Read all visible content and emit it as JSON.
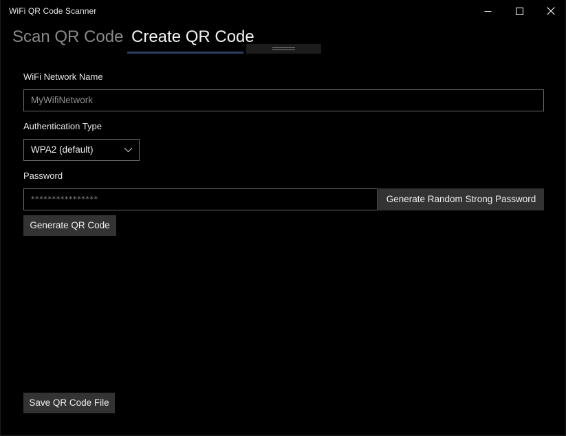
{
  "window": {
    "title": "WiFi QR Code Scanner",
    "caption": {
      "minimize_label": "Minimize",
      "maximize_label": "Maximize",
      "close_label": "Close"
    }
  },
  "tabs": [
    {
      "label": "Scan QR Code",
      "selected": false
    },
    {
      "label": "Create QR Code",
      "selected": true
    }
  ],
  "drag_handle": {
    "name": "window-drag-handle"
  },
  "form": {
    "ssid": {
      "label": "WiFi Network Name",
      "value": "",
      "placeholder": "MyWifiNetwork"
    },
    "auth": {
      "label": "Authentication Type",
      "selected": "WPA2 (default)",
      "options": [
        "WPA2 (default)"
      ]
    },
    "password": {
      "label": "Password",
      "value": "****************",
      "placeholder": ""
    },
    "generate_password_button": "Generate Random Strong Password",
    "generate_qr_button": "Generate QR Code",
    "save_button": "Save QR Code File"
  },
  "colors": {
    "background": "#000000",
    "accent_underline": "#2b3e66",
    "button_face": "#333333",
    "input_border": "#6b6b6b",
    "text_primary": "#f0f0f0",
    "text_muted": "#8a8a8a"
  }
}
